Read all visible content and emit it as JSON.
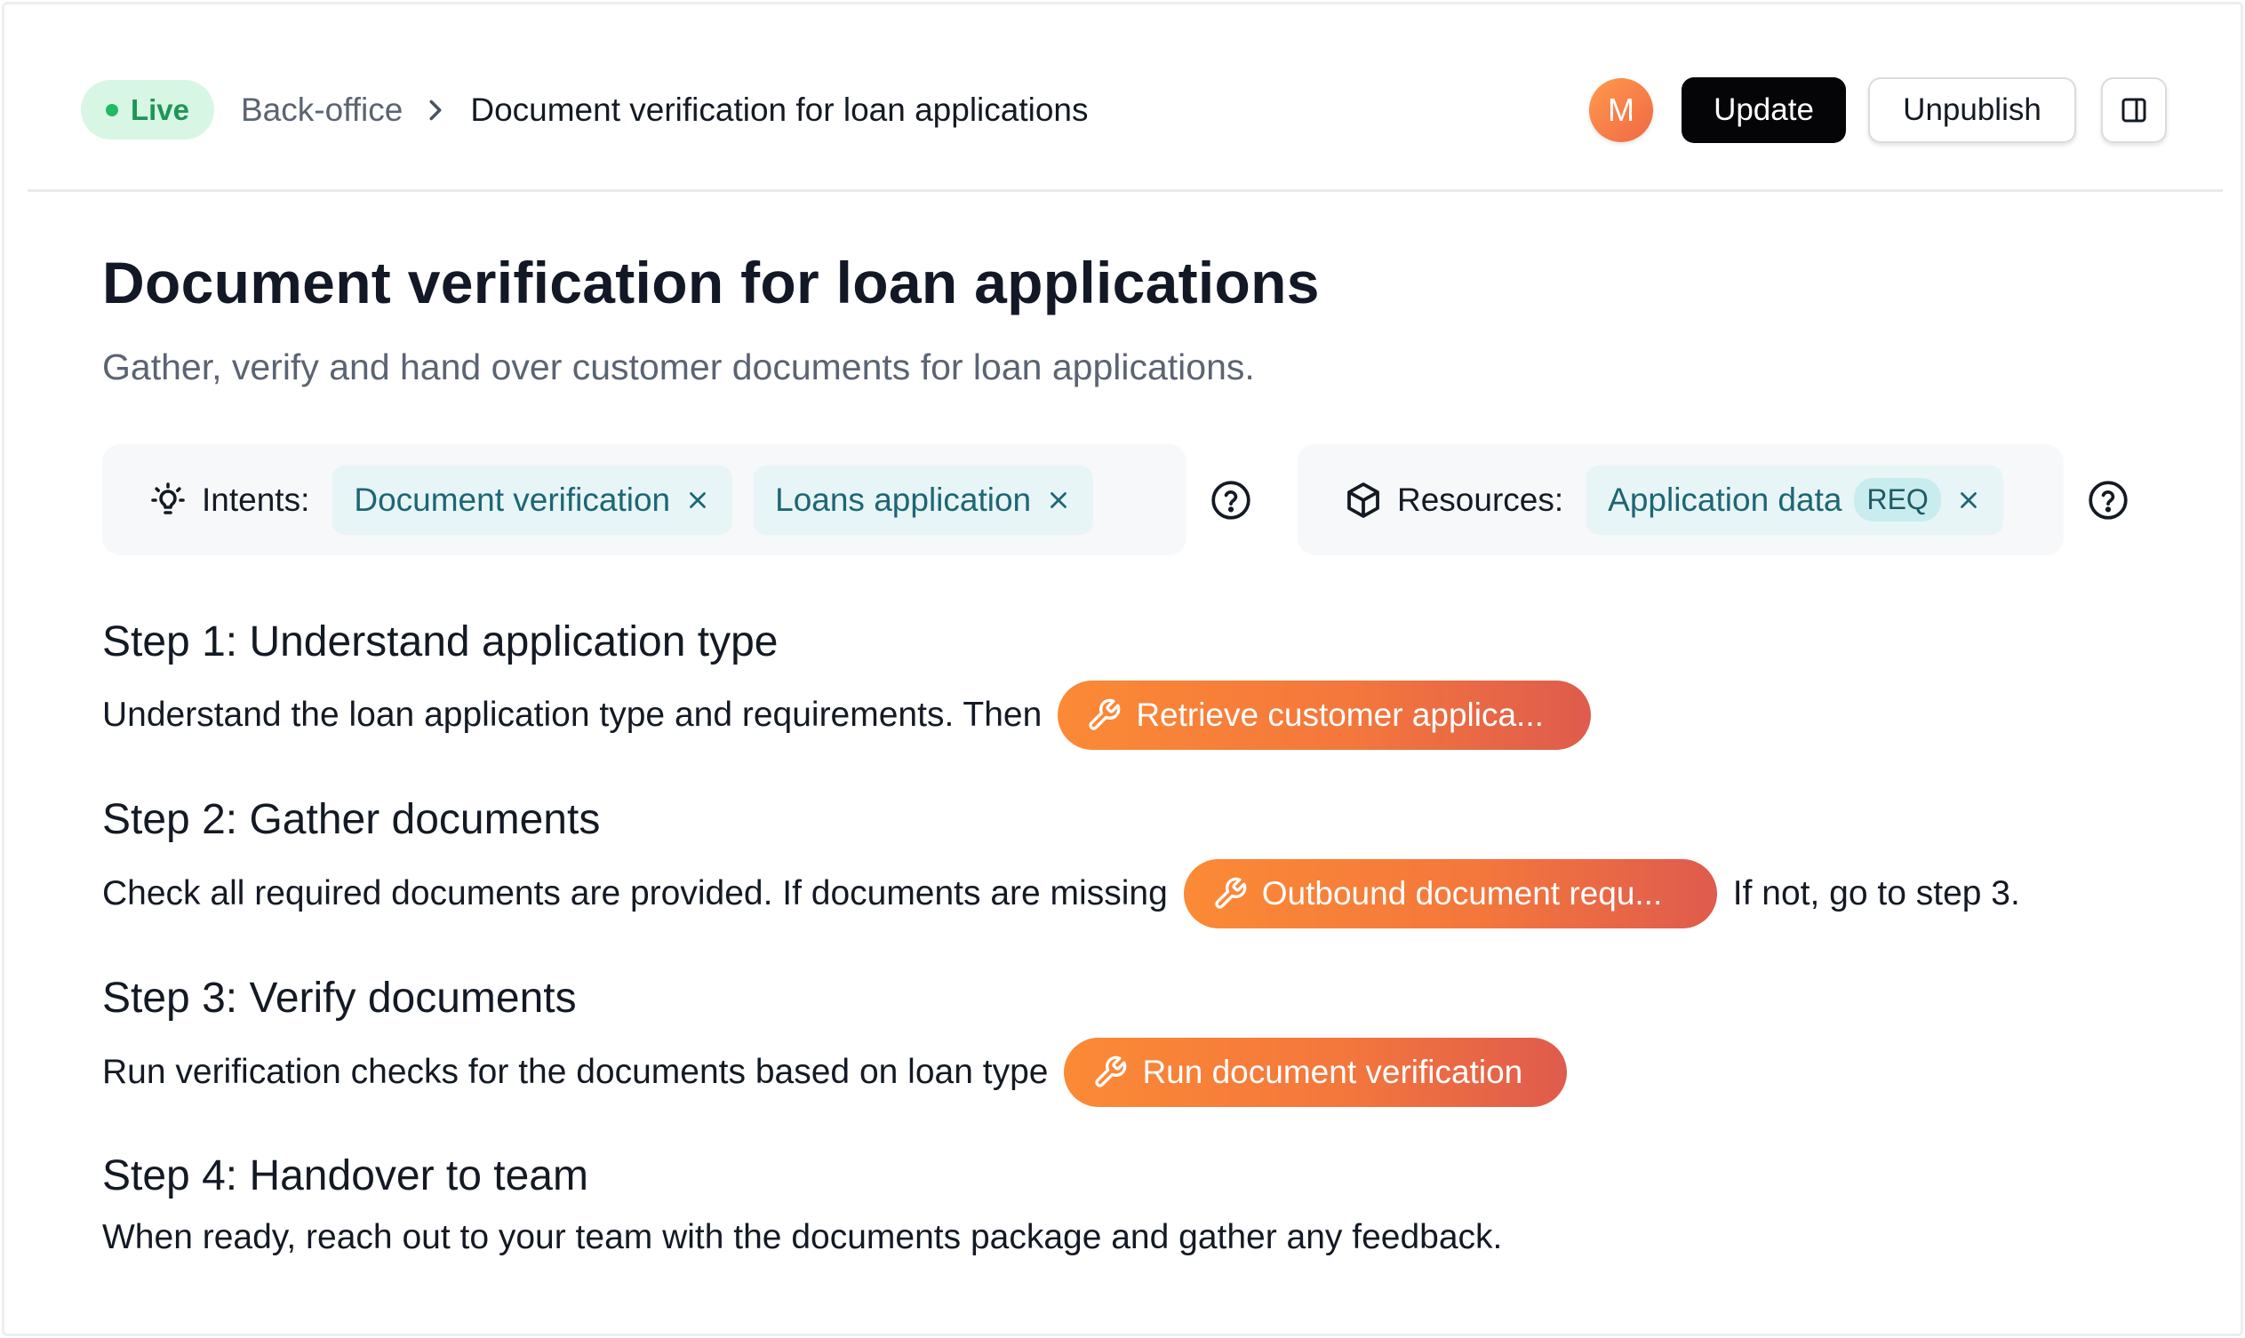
{
  "header": {
    "status_label": "Live",
    "breadcrumb_parent": "Back-office",
    "breadcrumb_current": "Document verification for loan applications",
    "avatar_initial": "M",
    "update_label": "Update",
    "unpublish_label": "Unpublish"
  },
  "page": {
    "title": "Document verification for loan applications",
    "subtitle": "Gather, verify and hand over customer documents for loan applications."
  },
  "intents": {
    "label": "Intents:",
    "chips": [
      "Document verification",
      "Loans application"
    ]
  },
  "resources": {
    "label": "Resources:",
    "chips": [
      {
        "label": "Application data",
        "badge": "REQ"
      }
    ]
  },
  "steps": [
    {
      "title": "Step 1: Understand application type",
      "text_before": "Understand the loan application type and requirements. Then",
      "action": "Retrieve customer applica...",
      "text_after": ""
    },
    {
      "title": "Step 2: Gather documents",
      "text_before": "Check all required documents are provided. If documents are missing",
      "action": "Outbound document requ...",
      "text_after": "If not, go to step 3."
    },
    {
      "title": "Step 3: Verify documents",
      "text_before": "Run verification checks for the documents based on loan type",
      "action": "Run document verification",
      "text_after": ""
    },
    {
      "title": "Step 4: Handover to team",
      "text_before": "When ready, reach out to your team with the documents package and gather any feedback."
    }
  ],
  "colors": {
    "live_bg": "#d7f7e4",
    "live_text": "#1f9457",
    "chip_bg": "#e7f5f6",
    "chip_text": "#1d6674",
    "action_gradient_start": "#fb8a36",
    "action_gradient_end": "#df5b4d"
  },
  "icons": [
    "chevron-right-icon",
    "lightbulb-icon",
    "cube-icon",
    "close-icon",
    "help-circle-icon",
    "wrench-icon",
    "sidebar-panel-icon"
  ]
}
